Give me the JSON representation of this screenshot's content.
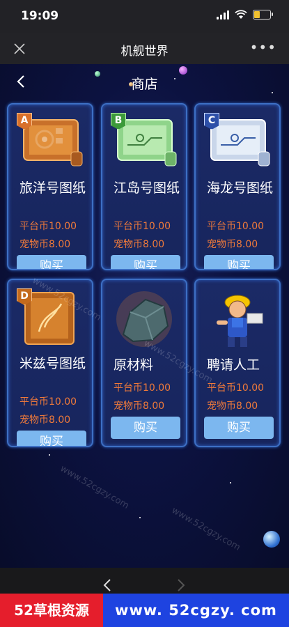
{
  "status": {
    "time": "19:09"
  },
  "app": {
    "title": "机舰世界",
    "more": "•••"
  },
  "shop": {
    "title": "商店"
  },
  "items": [
    {
      "badge": "A",
      "badge_color": "#d8702a",
      "name": "旅洋号图纸",
      "price_platform": "平台币10.00",
      "price_pet": "宠物币8.00",
      "buy": "购买"
    },
    {
      "badge": "B",
      "badge_color": "#3c9a3a",
      "name": "江岛号图纸",
      "price_platform": "平台币10.00",
      "price_pet": "宠物币8.00",
      "buy": "购买"
    },
    {
      "badge": "C",
      "badge_color": "#2d4fa8",
      "name": "海龙号图纸",
      "price_platform": "平台币10.00",
      "price_pet": "宠物币8.00",
      "buy": "购买"
    },
    {
      "badge": "D",
      "badge_color": "#c46a1d",
      "name": "米兹号图纸",
      "price_platform": "平台币10.00",
      "price_pet": "宠物币8.00",
      "buy": "购买"
    },
    {
      "badge": "",
      "name": "原材料",
      "price_platform": "平台币10.00",
      "price_pet": "宠物币8.00",
      "buy": "购买"
    },
    {
      "badge": "",
      "name": "聘请人工",
      "price_platform": "平台币10.00",
      "price_pet": "宠物币8.00",
      "buy": "购买"
    }
  ],
  "banner": {
    "left": "52草根资源",
    "right": "www. 52cgzy. com"
  },
  "watermark": "www.52cgzy.com"
}
